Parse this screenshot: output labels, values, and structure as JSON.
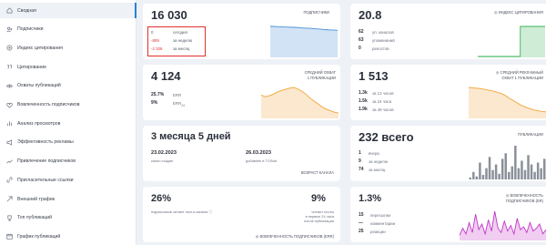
{
  "sidebar": {
    "items": [
      {
        "label": "Сводная",
        "icon": "home-icon"
      },
      {
        "label": "Подписчики",
        "icon": "user-plus-icon"
      },
      {
        "label": "Индекс цитирования",
        "icon": "target-icon"
      },
      {
        "label": "Цитирование",
        "icon": "quote-icon"
      },
      {
        "label": "Охваты публикаций",
        "icon": "eye-icon"
      },
      {
        "label": "Вовлеченность подписчиков",
        "icon": "heart-icon"
      },
      {
        "label": "Анализ просмотров",
        "icon": "bar-chart-icon"
      },
      {
        "label": "Эффективность рекламы",
        "icon": "megaphone-icon"
      },
      {
        "label": "Привлечение подписчиков",
        "icon": "trend-icon"
      },
      {
        "label": "Пригласительные ссылки",
        "icon": "link-icon"
      },
      {
        "label": "Внешний трафик",
        "icon": "arrow-icon"
      },
      {
        "label": "Топ публикаций",
        "icon": "trophy-icon"
      },
      {
        "label": "График публикаций",
        "icon": "calendar-icon"
      }
    ]
  },
  "subs": {
    "value": "16 030",
    "tag": "ПОДПИСЧИКИ",
    "rows": [
      {
        "num": "0",
        "label": "сегодня"
      },
      {
        "num": "-809",
        "label": "за неделю"
      },
      {
        "num": "-2 326",
        "label": "за месяц"
      }
    ]
  },
  "citation": {
    "value": "20.8",
    "tag": "ИНДЕКС ЦИТИРОВАНИЯ",
    "rows": [
      {
        "num": "62",
        "label": "уп. каналов"
      },
      {
        "num": "63",
        "label": "упоминаний"
      },
      {
        "num": "0",
        "label": "репостов"
      }
    ]
  },
  "reach": {
    "value": "4 124",
    "tag1": "СРЕДНИЙ ОХВАТ",
    "tag2": "1 ПУБЛИКАЦИИ",
    "err": "25.7%",
    "err_label": "ERR",
    "err24": "9%",
    "err24_label": "ERR",
    "err24_sub": "24"
  },
  "adreach": {
    "value": "1 513",
    "tag1": "СРЕДНИЙ РЕКЛАМНЫЙ",
    "tag2": "ОХВАТ 1 ПУБЛИКАЦИИ",
    "rows": [
      {
        "num": "1.3k",
        "label": "за 12 часов"
      },
      {
        "num": "1.5k",
        "label": "за 24 часа"
      },
      {
        "num": "1.9k",
        "label": "за 48 часов"
      }
    ]
  },
  "age": {
    "value": "3 месяца 5 дней",
    "created_date": "23.02.2023",
    "created_label": "канал создан",
    "added_date": "26.03.2023",
    "added_label": "добавлен в TGStat",
    "tag": "ВОЗРАСТ КАНАЛА"
  },
  "posts": {
    "value": "232 всего",
    "tag": "ПУБЛИКАЦИИ",
    "rows": [
      {
        "num": "1",
        "label": "вчера"
      },
      {
        "num": "9",
        "label": "за неделю"
      },
      {
        "num": "74",
        "label": "за месяц"
      }
    ]
  },
  "engage": {
    "left_value": "26%",
    "left_label": "подписчиков читают посты канала",
    "right_value": "9%",
    "right_l1": "читают посты",
    "right_l2": "в первые 24 часа",
    "right_l3": "после публикации",
    "tag": "ВОВЛЕЧЕННОСТЬ ПОДПИСЧИКОВ (ERR)"
  },
  "er": {
    "value": "1.3%",
    "tag1": "ВОВЛЕЧЕННОСТЬ",
    "tag2": "ПОДПИСЧИКОВ (ER)",
    "rows": [
      {
        "num": "15",
        "label": "пересылки"
      },
      {
        "num": "—",
        "label": "комментарии"
      },
      {
        "num": "25",
        "label": "реакции"
      }
    ]
  },
  "colors": {
    "accent": "#2a7fd4",
    "blue": "#4a90d9",
    "green": "#3cb55a",
    "orange": "#f0a53a",
    "gray": "#8a9099",
    "magenta": "#c236c9",
    "red": "#e0312b"
  },
  "series": {
    "subs": [
      100,
      100,
      99,
      99,
      98,
      98,
      97,
      97,
      96,
      95,
      94,
      94,
      93,
      92,
      91,
      90,
      89,
      88,
      88,
      87
    ],
    "citation": [
      0,
      0,
      0,
      0,
      0,
      0,
      0,
      0,
      0,
      0,
      0,
      0,
      98,
      98,
      98,
      98,
      98,
      98,
      98,
      98
    ],
    "reach": [
      60,
      55,
      58,
      62,
      68,
      72,
      75,
      78,
      80,
      76,
      70,
      62,
      52,
      44,
      36,
      28,
      22,
      18,
      14,
      12
    ],
    "adreach": [
      75,
      74,
      73,
      72,
      70,
      68,
      66,
      63,
      60,
      55,
      48,
      42,
      36,
      30,
      26,
      22,
      19,
      17,
      15,
      14
    ],
    "posts": [
      5,
      20,
      8,
      45,
      12,
      30,
      60,
      25,
      40,
      15,
      55,
      70,
      20,
      35,
      90,
      30,
      50,
      25,
      65,
      40,
      20,
      45,
      30,
      55
    ],
    "er": [
      15,
      40,
      20,
      60,
      25,
      90,
      35,
      55,
      20,
      70,
      30,
      100,
      40,
      25,
      65,
      30,
      50,
      20,
      75,
      35,
      45,
      25,
      60,
      30,
      40,
      55,
      20,
      35
    ]
  }
}
